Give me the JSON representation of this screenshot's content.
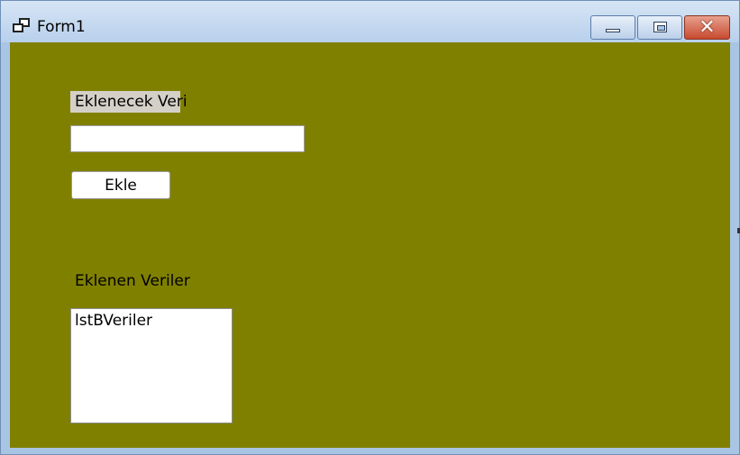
{
  "window": {
    "title": "Form1",
    "controls": {
      "close_symbol": "✕"
    },
    "client_color": "#808000"
  },
  "form": {
    "add_label": "Eklenecek Veri",
    "add_input_value": "",
    "add_button": "Ekle",
    "list_label": "Eklenen Veriler",
    "listbox_items": [
      "lstBVeriler"
    ]
  }
}
